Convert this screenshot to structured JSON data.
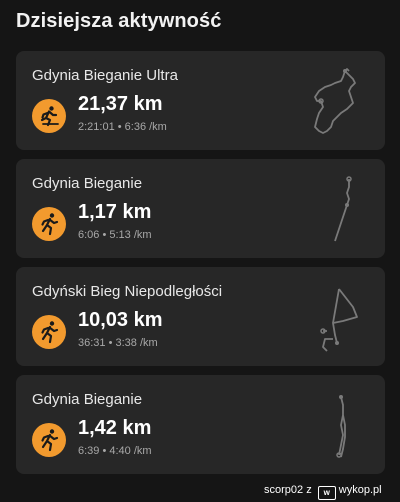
{
  "header": {
    "title": "Dzisiejsza aktywność"
  },
  "activities": [
    {
      "title": "Gdynia Bieganie Ultra",
      "distance": "21,37 km",
      "stats": "2:21:01 • 6:36 /km",
      "icon": "running-person-icon"
    },
    {
      "title": "Gdynia Bieganie",
      "distance": "1,17 km",
      "stats": "6:06 • 5:13 /km",
      "icon": "running-person-icon"
    },
    {
      "title": "Gdyński Bieg Niepodległości",
      "distance": "10,03 km",
      "stats": "36:31 • 3:38 /km",
      "icon": "running-person-icon"
    },
    {
      "title": "Gdynia Bieganie",
      "distance": "1,42 km",
      "stats": "6:39 • 4:40 /km",
      "icon": "running-person-icon"
    }
  ],
  "watermark": {
    "user": "scorp02",
    "separator": "z",
    "site": "wykop.pl"
  },
  "colors": {
    "accent": "#f29a2e",
    "card": "#272727",
    "background": "#151515"
  }
}
